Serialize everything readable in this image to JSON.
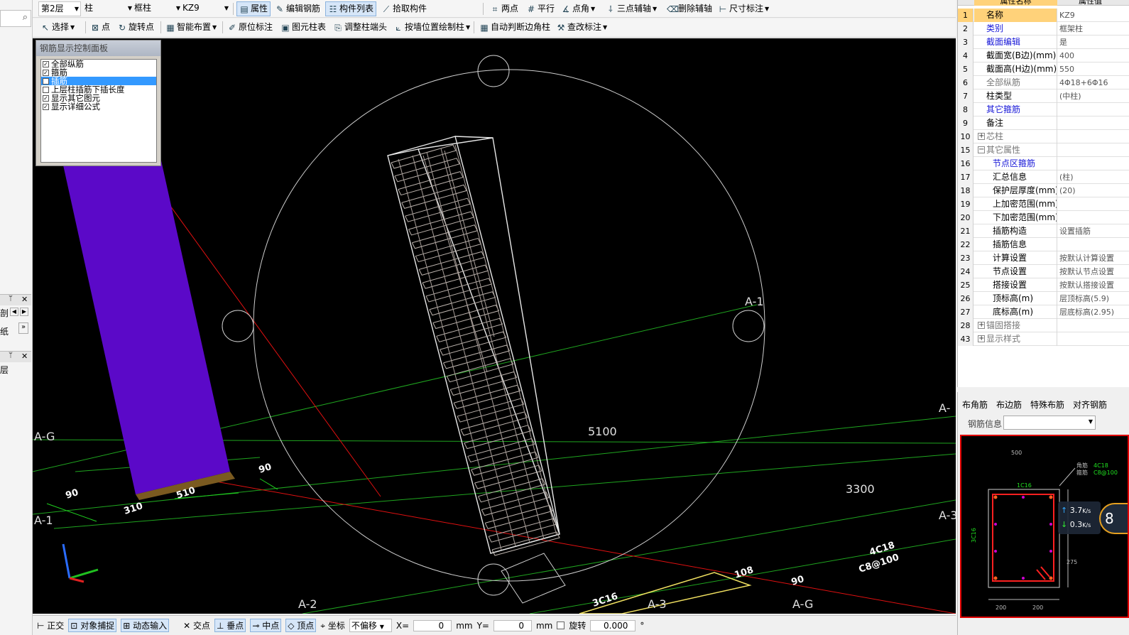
{
  "toolbar1": {
    "floor": "第2层",
    "category": "柱",
    "subtype": "框柱",
    "component": "KZ9",
    "btn_property": "属性",
    "btn_edit_rebar": "编辑钢筋",
    "btn_component_list": "构件列表",
    "btn_pick_component": "拾取构件",
    "btn_two_points": "两点",
    "btn_parallel": "平行",
    "btn_point_angle": "点角",
    "btn_three_point_axis": "三点辅轴",
    "btn_delete_axis": "删除辅轴",
    "btn_dimension": "尺寸标注"
  },
  "toolbar2": {
    "btn_select": "选择",
    "btn_point": "点",
    "btn_rotate_point": "旋转点",
    "btn_smart_layout": "智能布置",
    "btn_in_situ_mark": "原位标注",
    "btn_element_table": "图元柱表",
    "btn_adjust_head": "调整柱端头",
    "btn_draw_by_wall": "按墙位置绘制柱",
    "btn_auto_corner": "自动判断边角柱",
    "btn_modify_mark": "查改标注"
  },
  "left_strip": {
    "tab1": "剖",
    "tab2": "纸",
    "tab3": "层"
  },
  "rebar_panel": {
    "title": "钢筋显示控制面板",
    "items": [
      {
        "label": "全部纵筋",
        "checked": true
      },
      {
        "label": "箍筋",
        "checked": true
      },
      {
        "label": "插筋",
        "checked": false
      },
      {
        "label": "上层柱插筋下插长度",
        "checked": false
      },
      {
        "label": "显示其它图元",
        "checked": true
      },
      {
        "label": "显示详细公式",
        "checked": true
      }
    ],
    "selected_index": 2
  },
  "viewport": {
    "labels": {
      "a1_right": "A-1",
      "ag_left": "A-G",
      "a1_left": "A-1",
      "a2_bottom": "A-2",
      "a3_bottom": "A-3",
      "ag_bottom": "A-G",
      "a_right_top": "A-",
      "a3_right": "A-3",
      "dim_5100": "5100",
      "dim_3300": "3300",
      "d90": "90",
      "d310": "310",
      "d510": "510",
      "d90b": "90",
      "d108": "108",
      "d90c": "90",
      "c3c16": "3C16",
      "c4c18": "4C18",
      "c8100": "C8@100"
    }
  },
  "statusbar": {
    "ortho": "正交",
    "snap": "对象捕捉",
    "dynamic": "动态输入",
    "intersection": "交点",
    "perpendicular": "垂点",
    "midpoint": "中点",
    "vertex": "顶点",
    "coordinate": "坐标",
    "no_offset": "不偏移",
    "x_label": "X=",
    "x_value": "0",
    "mm1": "mm",
    "y_label": "Y=",
    "y_value": "0",
    "mm2": "mm",
    "rotate": "旋转",
    "rotate_value": "0.000",
    "degree": "°"
  },
  "property_panel": {
    "header_name": "属性名称",
    "header_value": "属性值",
    "rows": [
      {
        "num": "1",
        "name": "名称",
        "value": "KZ9",
        "style": "blue",
        "hl": true
      },
      {
        "num": "2",
        "name": "类别",
        "value": "框架柱",
        "style": "blue"
      },
      {
        "num": "3",
        "name": "截面编辑",
        "value": "是",
        "style": "blue"
      },
      {
        "num": "4",
        "name": "截面宽(B边)(mm)",
        "value": "400",
        "style": "black"
      },
      {
        "num": "5",
        "name": "截面高(H边)(mm)",
        "value": "550",
        "style": "black"
      },
      {
        "num": "6",
        "name": "全部纵筋",
        "value": "4Φ18+6Φ16",
        "style": "gray"
      },
      {
        "num": "7",
        "name": "柱类型",
        "value": "(中柱)",
        "style": "black"
      },
      {
        "num": "8",
        "name": "其它箍筋",
        "value": "",
        "style": "blue"
      },
      {
        "num": "9",
        "name": "备注",
        "value": "",
        "style": "black"
      },
      {
        "num": "10",
        "name": "芯柱",
        "value": "",
        "style": "gray",
        "exp": "+"
      },
      {
        "num": "15",
        "name": "其它属性",
        "value": "",
        "style": "gray",
        "exp": "−"
      },
      {
        "num": "16",
        "name": "节点区箍筋",
        "value": "",
        "style": "blue",
        "indent": true
      },
      {
        "num": "17",
        "name": "汇总信息",
        "value": "(柱)",
        "style": "black",
        "indent": true
      },
      {
        "num": "18",
        "name": "保护层厚度(mm)",
        "value": "(20)",
        "style": "black",
        "indent": true
      },
      {
        "num": "19",
        "name": "上加密范围(mm)",
        "value": "",
        "style": "black",
        "indent": true
      },
      {
        "num": "20",
        "name": "下加密范围(mm)",
        "value": "",
        "style": "black",
        "indent": true
      },
      {
        "num": "21",
        "name": "插筋构造",
        "value": "设置插筋",
        "style": "black",
        "indent": true
      },
      {
        "num": "22",
        "name": "插筋信息",
        "value": "",
        "style": "black",
        "indent": true
      },
      {
        "num": "23",
        "name": "计算设置",
        "value": "按默认计算设置",
        "style": "black",
        "indent": true
      },
      {
        "num": "24",
        "name": "节点设置",
        "value": "按默认节点设置",
        "style": "black",
        "indent": true
      },
      {
        "num": "25",
        "name": "搭接设置",
        "value": "按默认搭接设置",
        "style": "black",
        "indent": true
      },
      {
        "num": "26",
        "name": "顶标高(m)",
        "value": "层顶标高(5.9)",
        "style": "black",
        "indent": true
      },
      {
        "num": "27",
        "name": "底标高(m)",
        "value": "层底标高(2.95)",
        "style": "black",
        "indent": true
      },
      {
        "num": "28",
        "name": "锚固搭接",
        "value": "",
        "style": "gray",
        "exp": "+"
      },
      {
        "num": "43",
        "name": "显示样式",
        "value": "",
        "style": "gray",
        "exp": "+"
      }
    ]
  },
  "bottom_panel": {
    "tab_corner": "布角筋",
    "tab_edge": "布边筋",
    "tab_special": "特殊布筋",
    "tab_align": "对齐钢筋",
    "info_label": "钢筋信息",
    "sec_500": "500",
    "sec_1c16": "1C16",
    "sec_3c16": "3C16",
    "sec_275": "275",
    "sec_200a": "200",
    "sec_200b": "200",
    "sec_corner": "角筋",
    "sec_stirrup": "箍筋",
    "sec_4c18": "4C18",
    "sec_c8": "C8@100",
    "speed_up": "3.7",
    "speed_down": "0.3",
    "speed_unit": "K/s",
    "speed_badge": "8"
  }
}
